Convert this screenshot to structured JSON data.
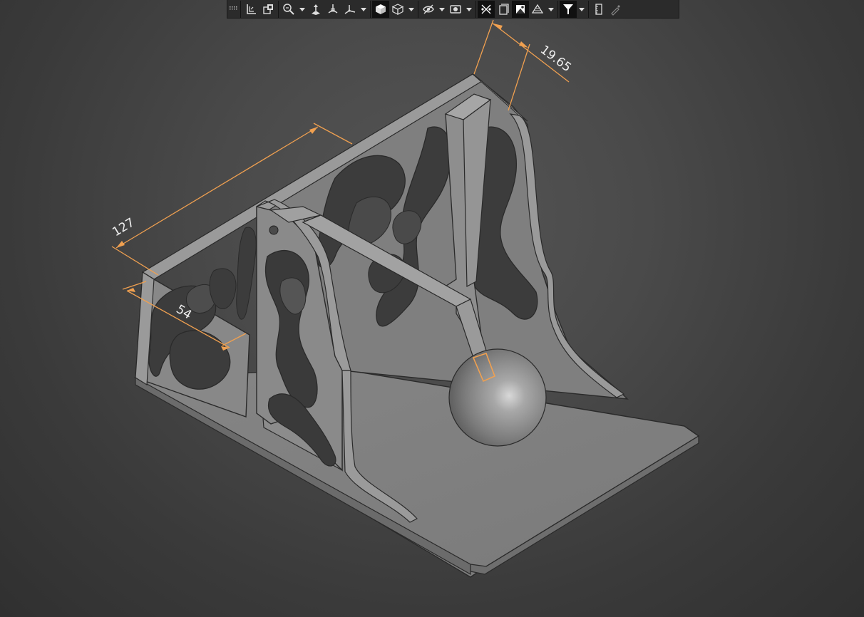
{
  "viewport": {
    "background": "#454545",
    "model_color": "#8a8a8a",
    "dimension_color": "#f0a050"
  },
  "dimensions": {
    "length": "127",
    "width": "54",
    "thickness": "19.65"
  },
  "toolbar": {
    "buttons": [
      {
        "icon": "grip-icon",
        "active": false
      },
      {
        "icon": "previous-view-icon",
        "active": false
      },
      {
        "icon": "section-view-icon",
        "active": false
      },
      {
        "icon": "zoom-to-fit-icon",
        "active": false
      },
      {
        "icon": "view-orientation-icon",
        "active": false
      },
      {
        "icon": "standard-views-icon",
        "active": false
      },
      {
        "icon": "view-triad-icon",
        "active": false
      },
      {
        "icon": "shaded-display-icon",
        "active": true
      },
      {
        "icon": "wireframe-display-icon",
        "active": false
      },
      {
        "icon": "hide-show-items-icon",
        "active": false
      },
      {
        "icon": "edit-appearance-icon",
        "active": false
      },
      {
        "icon": "view-sketch-relations-icon",
        "active": true
      },
      {
        "icon": "view-settings-icon",
        "active": false
      },
      {
        "icon": "apply-scene-icon",
        "active": true
      },
      {
        "icon": "display-style-icon",
        "active": false
      },
      {
        "icon": "filter-icon",
        "active": true
      },
      {
        "icon": "measure-icon",
        "active": false
      },
      {
        "icon": "color-picker-icon",
        "active": false
      }
    ]
  }
}
